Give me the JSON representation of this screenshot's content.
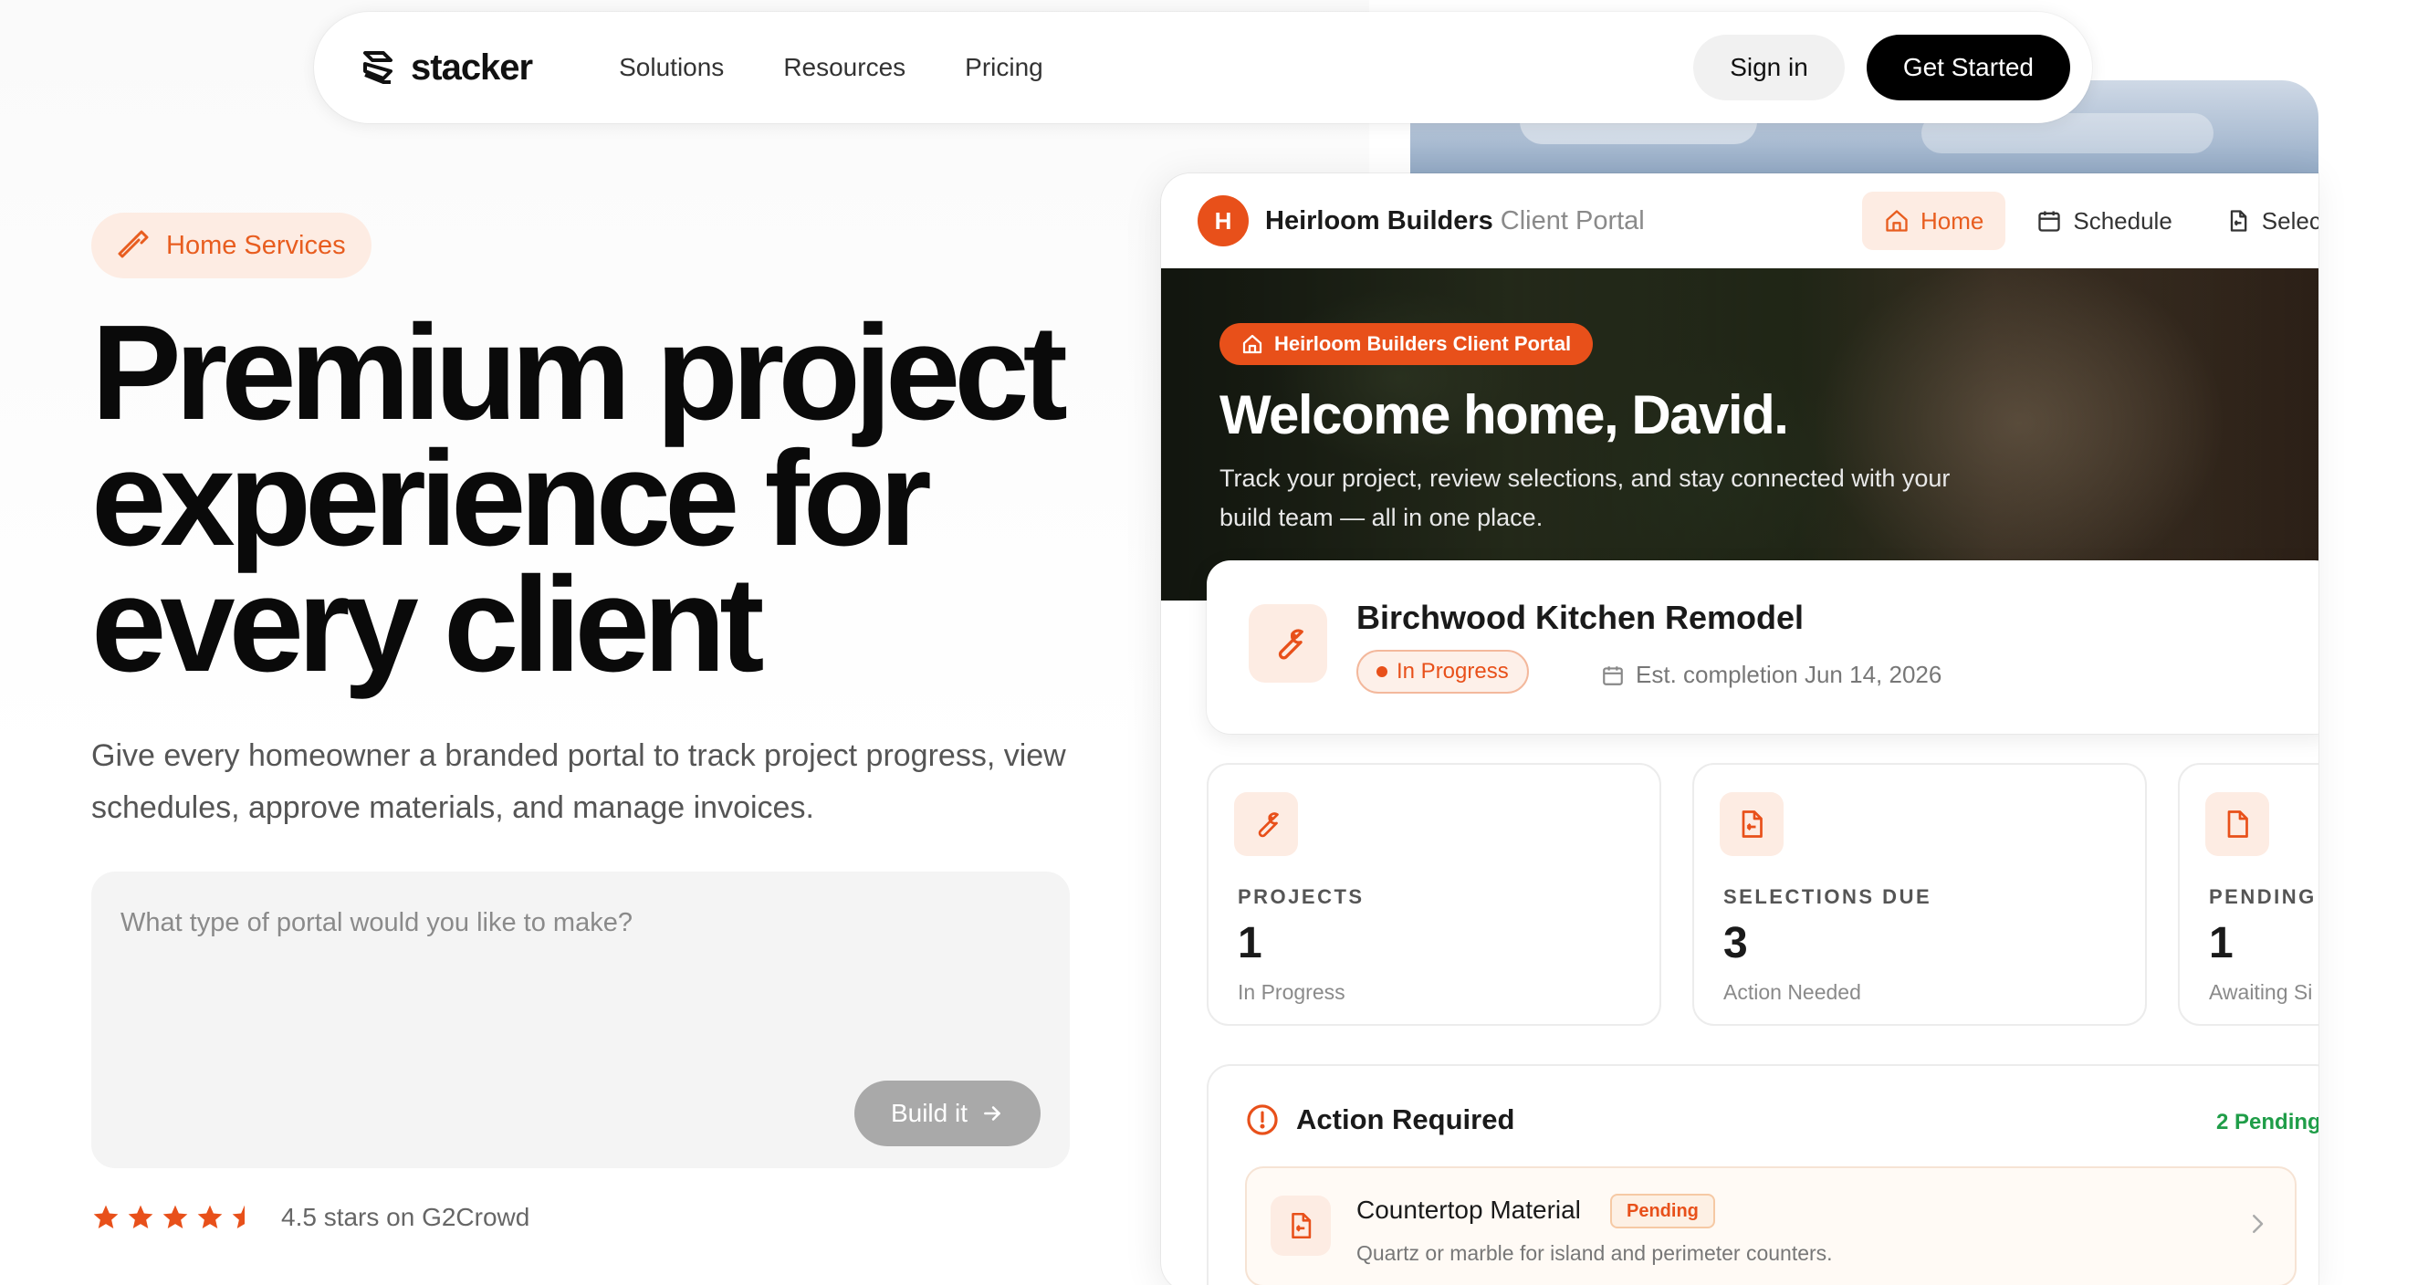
{
  "nav": {
    "logo_text": "stacker",
    "links": [
      "Solutions",
      "Resources",
      "Pricing"
    ],
    "sign_in": "Sign in",
    "get_started": "Get Started"
  },
  "hero": {
    "pill_label": "Home Services",
    "title_lines": [
      "Premium project",
      "experience for",
      "every client"
    ],
    "subtitle": "Give every homeowner a branded portal to track project progress, view schedules, approve materials, and manage invoices.",
    "prompt_placeholder": "What type of portal would you like to make?",
    "build_button": "Build it",
    "rating_text": "4.5 stars on G2Crowd",
    "rating_value": 4.5
  },
  "portal": {
    "brand_initial": "H",
    "brand_name": "Heirloom Builders",
    "brand_sub": "Client Portal",
    "nav": [
      {
        "label": "Home",
        "icon": "home-icon",
        "active": true
      },
      {
        "label": "Schedule",
        "icon": "calendar-icon",
        "active": false
      },
      {
        "label": "Selecti",
        "icon": "file-swap-icon",
        "active": false
      }
    ],
    "badge": "Heirloom Builders Client Portal",
    "welcome": "Welcome home, David.",
    "welcome_sub": "Track your project, review selections, and stay connected with your build team — all in one place.",
    "project": {
      "title": "Birchwood Kitchen Remodel",
      "status": "In Progress",
      "est": "Est. completion Jun 14, 2026"
    },
    "stats": [
      {
        "label": "PROJECTS",
        "value": "1",
        "sub": "In Progress",
        "icon": "wrench-icon"
      },
      {
        "label": "SELECTIONS DUE",
        "value": "3",
        "sub": "Action Needed",
        "icon": "file-swap-icon"
      },
      {
        "label": "PENDING I",
        "value": "1",
        "sub": "Awaiting Si",
        "icon": "document-icon"
      }
    ],
    "action": {
      "title": "Action Required",
      "count": "2 Pending",
      "item_title": "Countertop Material",
      "item_badge": "Pending",
      "item_desc": "Quartz or marble for island and perimeter counters."
    }
  },
  "colors": {
    "accent": "#e8501a",
    "accent_soft": "#fdece3",
    "success": "#1f9d48",
    "dark": "#000000"
  }
}
